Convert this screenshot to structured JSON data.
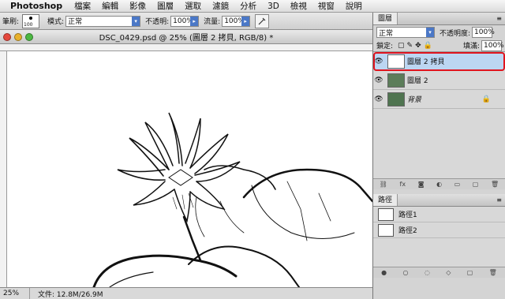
{
  "menubar": {
    "app": "Photoshop",
    "items": [
      "檔案",
      "編輯",
      "影像",
      "圖層",
      "選取",
      "濾鏡",
      "分析",
      "3D",
      "檢視",
      "視窗",
      "說明"
    ]
  },
  "options": {
    "brush_label": "筆刷:",
    "brush_size": "100",
    "mode_label": "模式:",
    "mode_value": "正常",
    "opacity_label": "不透明:",
    "opacity_value": "100%",
    "flow_label": "流量:",
    "flow_value": "100%"
  },
  "document": {
    "title": "DSC_0429.psd @ 25% (圖層 2 拷貝, RGB/8) *",
    "zoom": "25%",
    "file_info": "文件: 12.8M/26.9M"
  },
  "layers_panel": {
    "tab": "圖層",
    "blend_mode": "正常",
    "opacity_label": "不透明度:",
    "opacity_value": "100%",
    "lock_label": "鎖定:",
    "fill_label": "填滿:",
    "fill_value": "100%",
    "layers": [
      {
        "name": "圖層 2 拷貝",
        "selected": true
      },
      {
        "name": "圖層 2",
        "selected": false
      },
      {
        "name": "背景",
        "selected": false
      }
    ]
  },
  "paths_panel": {
    "tab": "路徑",
    "paths": [
      {
        "name": "路徑1"
      },
      {
        "name": "路徑2"
      }
    ]
  },
  "colors": {
    "selection": "#bcd6f2",
    "highlight": "#e0141e"
  }
}
